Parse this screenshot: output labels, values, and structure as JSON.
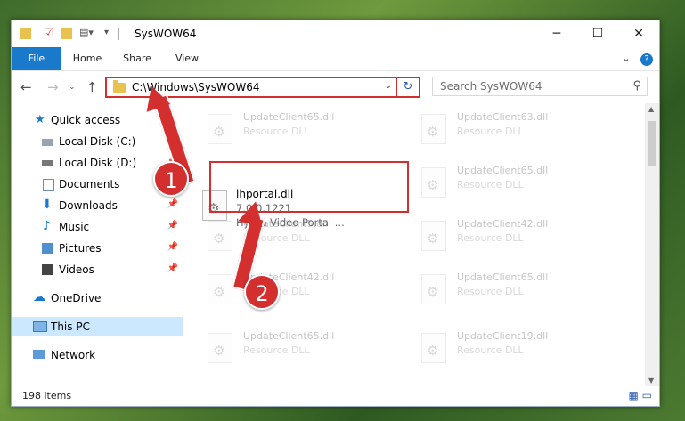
{
  "window": {
    "title": "SysWOW64"
  },
  "ribbon": {
    "tabs": [
      "File",
      "Home",
      "Share",
      "View"
    ]
  },
  "address": {
    "path": "C:\\Windows\\SysWOW64"
  },
  "search": {
    "placeholder": "Search SysWOW64"
  },
  "nav": {
    "quick_access": "Quick access",
    "local_c": "Local Disk (C:)",
    "local_d": "Local Disk (D:)",
    "documents": "Documents",
    "downloads": "Downloads",
    "music": "Music",
    "pictures": "Pictures",
    "videos": "Videos",
    "onedrive": "OneDrive",
    "this_pc": "This PC",
    "network": "Network"
  },
  "files": [
    {
      "name": "UpdateClient65.dll",
      "type": "Resource DLL"
    },
    {
      "name": "UpdateClient63.dll",
      "type": "Resource DLL"
    },
    {
      "name": "lhportal.dll",
      "version": "7.0.0.1221",
      "desc": "Hydra Video Portal ..."
    },
    {
      "name": "UpdateClient65.dll",
      "type": "Resource DLL"
    },
    {
      "name": "UpdateClient5.dll",
      "type": "Resource DLL"
    },
    {
      "name": "UpdateClient42.dll",
      "type": "Resource DLL"
    },
    {
      "name": "UpdateClient42.dll",
      "type": "Resource DLL"
    },
    {
      "name": "UpdateClient65.dll",
      "type": "Resource DLL"
    },
    {
      "name": "UpdateClient65.dll",
      "type": "Resource DLL"
    },
    {
      "name": "UpdateClient19.dll",
      "type": "Resource DLL"
    }
  ],
  "status": {
    "count": "198 items"
  },
  "callouts": {
    "one": "1",
    "two": "2"
  },
  "colors": {
    "accent": "#1979ca",
    "highlight": "#d32f2f"
  }
}
